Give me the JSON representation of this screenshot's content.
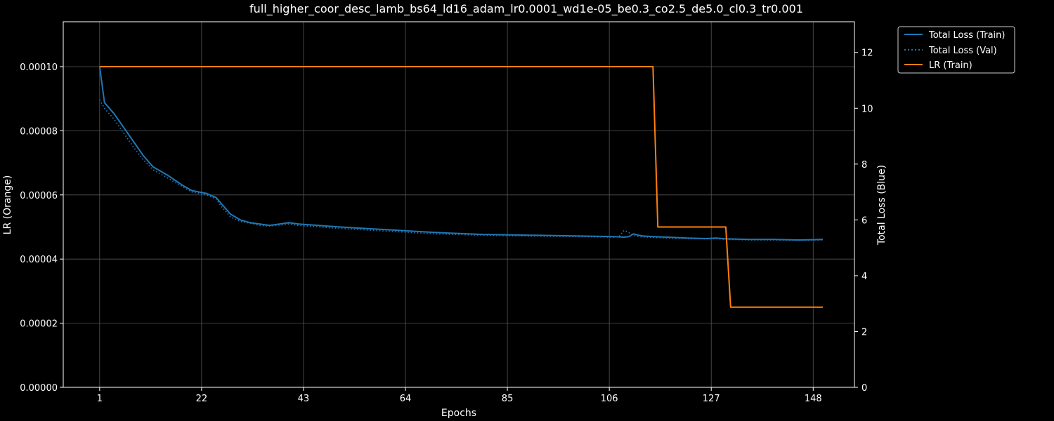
{
  "chart_data": {
    "type": "line",
    "title": "full_higher_coor_desc_lamb_bs64_ld16_adam_lr0.0001_wd1e-05_be0.3_co2.5_de5.0_cl0.3_tr0.001",
    "xlabel": "Epochs",
    "ylabel_left": "LR (Orange)",
    "ylabel_right": "Total Loss (Blue)",
    "xlim": [
      -6.5,
      156.5
    ],
    "ylim_left": [
      0,
      0.000114
    ],
    "ylim_right": [
      0,
      13.1
    ],
    "x_ticks": [
      1,
      22,
      43,
      64,
      85,
      106,
      127,
      148
    ],
    "y_left_ticks": [
      "0.00000",
      "0.00002",
      "0.00004",
      "0.00006",
      "0.00008",
      "0.00010"
    ],
    "y_left_tick_values": [
      0,
      2e-05,
      4e-05,
      6e-05,
      8e-05,
      0.0001
    ],
    "y_right_ticks": [
      0,
      2,
      4,
      6,
      8,
      10,
      12
    ],
    "grid": true,
    "legend_position": "outside-top-right",
    "colors": {
      "train": "#1f77b4",
      "val": "#1f77b4",
      "lr": "#ff7f0e",
      "grid": "#555555",
      "axis": "#ffffff"
    },
    "series": [
      {
        "name": "Total Loss (Train)",
        "axis": "right",
        "style": "solid",
        "x": [
          1,
          2,
          4,
          6,
          8,
          10,
          12,
          15,
          18,
          20,
          23,
          25,
          26,
          27,
          28,
          30,
          32,
          34,
          36,
          40,
          42,
          46,
          50,
          60,
          70,
          80,
          90,
          100,
          107,
          109,
          110,
          111,
          112,
          113,
          115,
          118,
          122,
          126,
          128,
          130,
          135,
          140,
          145,
          150
        ],
        "y": [
          11.5,
          10.2,
          9.8,
          9.3,
          8.8,
          8.3,
          7.9,
          7.6,
          7.25,
          7.05,
          6.95,
          6.8,
          6.6,
          6.4,
          6.2,
          6.0,
          5.9,
          5.85,
          5.8,
          5.9,
          5.85,
          5.8,
          5.75,
          5.65,
          5.55,
          5.48,
          5.45,
          5.42,
          5.4,
          5.38,
          5.4,
          5.5,
          5.45,
          5.42,
          5.4,
          5.38,
          5.35,
          5.33,
          5.35,
          5.32,
          5.3,
          5.3,
          5.28,
          5.3
        ]
      },
      {
        "name": "Total Loss (Val)",
        "axis": "right",
        "style": "dotted",
        "x": [
          1,
          2,
          4,
          6,
          8,
          10,
          12,
          15,
          18,
          20,
          23,
          25,
          26,
          27,
          28,
          30,
          32,
          34,
          36,
          40,
          42,
          46,
          50,
          60,
          70,
          80,
          90,
          100,
          107,
          108,
          109,
          110,
          111,
          112,
          115,
          118,
          122,
          126,
          128,
          130,
          135,
          140,
          145,
          150
        ],
        "y": [
          10.3,
          10.0,
          9.6,
          9.1,
          8.6,
          8.15,
          7.8,
          7.5,
          7.2,
          7.0,
          6.9,
          6.75,
          6.5,
          6.3,
          6.1,
          5.95,
          5.88,
          5.8,
          5.78,
          5.85,
          5.8,
          5.75,
          5.7,
          5.6,
          5.5,
          5.45,
          5.42,
          5.4,
          5.38,
          5.4,
          5.62,
          5.55,
          5.45,
          5.4,
          5.37,
          5.35,
          5.33,
          5.32,
          5.33,
          5.3,
          5.28,
          5.28,
          5.27,
          5.28
        ]
      },
      {
        "name": "LR (Train)",
        "axis": "left",
        "style": "solid",
        "x": [
          1,
          115,
          116,
          130,
          131,
          150
        ],
        "y": [
          0.0001,
          0.0001,
          5e-05,
          5e-05,
          2.5e-05,
          2.5e-05
        ]
      }
    ]
  }
}
